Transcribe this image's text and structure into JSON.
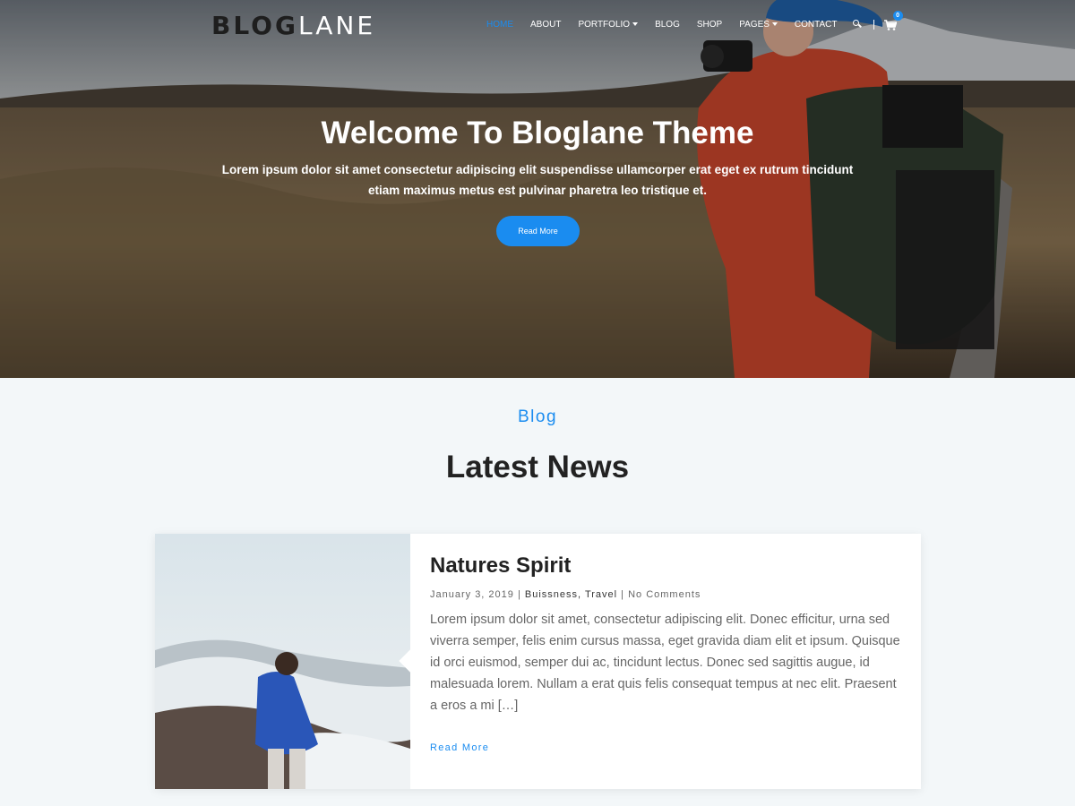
{
  "brand": {
    "logo_dark": "BLOG",
    "logo_light": "LANE"
  },
  "nav": {
    "items": [
      {
        "label": "HOME",
        "active": true
      },
      {
        "label": "ABOUT"
      },
      {
        "label": "PORTFOLIO",
        "dropdown": true
      },
      {
        "label": "BLOG"
      },
      {
        "label": "SHOP"
      },
      {
        "label": "PAGES",
        "dropdown": true
      },
      {
        "label": "CONTACT"
      }
    ],
    "cart_count": "0"
  },
  "hero": {
    "title": "Welcome To Bloglane Theme",
    "text": "Lorem ipsum dolor sit amet consectetur adipiscing elit suspendisse ullamcorper erat eget ex rutrum tincidunt etiam maximus metus est pulvinar pharetra leo tristique et.",
    "button": "Read More"
  },
  "blog_section": {
    "label": "Blog",
    "title": "Latest News",
    "posts": [
      {
        "title": "Natures Spirit",
        "date": "January 3, 2019",
        "category_1": "Buissness",
        "category_2": "Travel",
        "comments": "No Comments",
        "excerpt": "Lorem ipsum dolor sit amet, consectetur adipiscing elit. Donec efficitur, urna sed viverra semper, felis enim cursus massa, eget gravida diam elit et ipsum. Quisque id orci euismod, semper dui ac, tincidunt lectus. Donec sed sagittis augue, id malesuada lorem. Nullam a erat quis felis consequat tempus at nec elit. Praesent a eros a mi […]",
        "read_more": "Read More"
      }
    ]
  },
  "colors": {
    "accent": "#1a8cf0",
    "background": "#f3f7f9",
    "text": "#222222"
  }
}
